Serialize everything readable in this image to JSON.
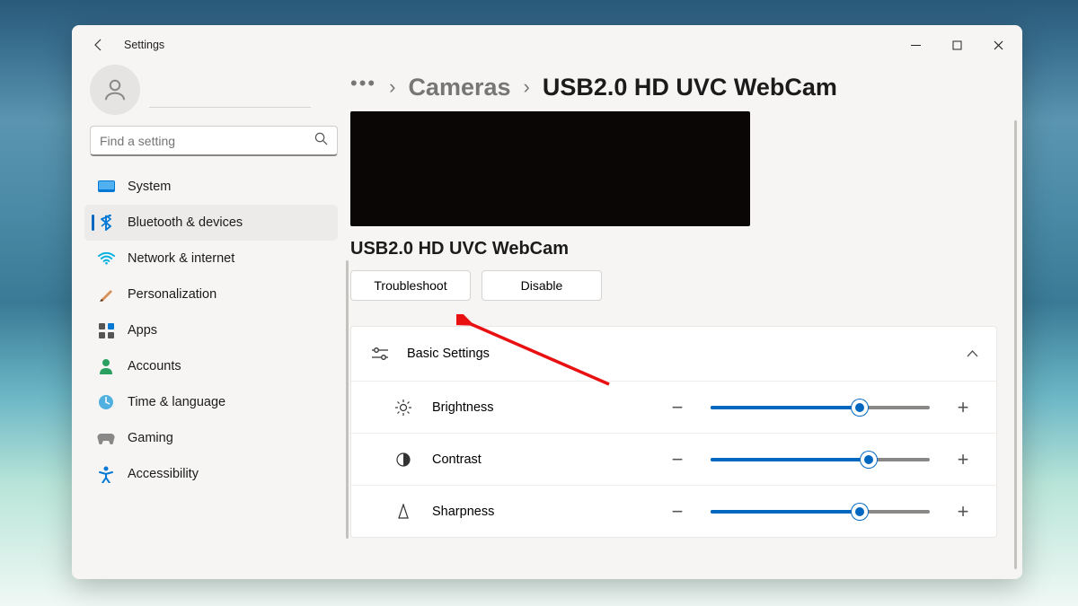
{
  "app_title": "Settings",
  "search": {
    "placeholder": "Find a setting"
  },
  "nav": {
    "items": [
      {
        "label": "System"
      },
      {
        "label": "Bluetooth & devices"
      },
      {
        "label": "Network & internet"
      },
      {
        "label": "Personalization"
      },
      {
        "label": "Apps"
      },
      {
        "label": "Accounts"
      },
      {
        "label": "Time & language"
      },
      {
        "label": "Gaming"
      },
      {
        "label": "Accessibility"
      }
    ],
    "active_index": 1
  },
  "breadcrumb": {
    "parent": "Cameras",
    "current": "USB2.0 HD UVC WebCam"
  },
  "device": {
    "name": "USB2.0 HD UVC WebCam",
    "actions": {
      "troubleshoot": "Troubleshoot",
      "disable": "Disable"
    }
  },
  "basic_settings": {
    "title": "Basic Settings",
    "rows": [
      {
        "label": "Brightness",
        "value_pct": 68
      },
      {
        "label": "Contrast",
        "value_pct": 72
      },
      {
        "label": "Sharpness",
        "value_pct": 68
      }
    ]
  },
  "colors": {
    "accent": "#0067c0"
  }
}
